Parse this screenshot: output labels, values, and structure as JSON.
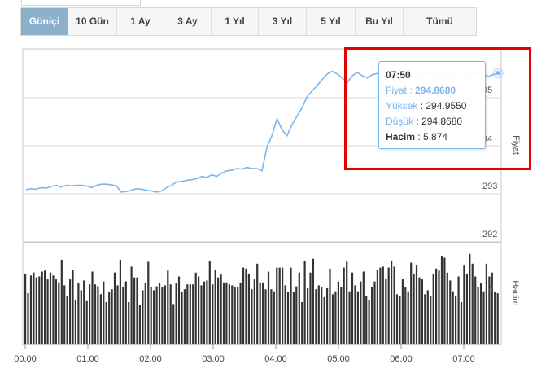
{
  "tabs": [
    {
      "label": "Güniçi",
      "active": true
    },
    {
      "label": "10 Gün",
      "active": false
    },
    {
      "label": "1 Ay",
      "active": false
    },
    {
      "label": "3 Ay",
      "active": false
    },
    {
      "label": "1 Yıl",
      "active": false
    },
    {
      "label": "3 Yıl",
      "active": false
    },
    {
      "label": "5 Yıl",
      "active": false
    },
    {
      "label": "Bu Yıl",
      "active": false
    },
    {
      "label": "Tümü",
      "active": false
    }
  ],
  "colors": {
    "accent": "#8ab0cc",
    "line": "#7cb5ec",
    "volume_bar": "#333333",
    "highlight_box": "#e60000"
  },
  "tooltip": {
    "time": "07:50",
    "price_label": "Fiyat",
    "price_value": "294.8680",
    "high_label": "Yüksek",
    "high_value": "294.9550",
    "low_label": "Düşük",
    "low_value": "294.8680",
    "volume_label": "Hacim",
    "volume_value": "5.874"
  },
  "chart_data": [
    {
      "type": "line",
      "ylabel": "Fiyat",
      "ylim": [
        291.85,
        295.3
      ],
      "yticks": [
        "292",
        "293",
        "94",
        "95"
      ],
      "x": [
        "00:00",
        "00:05",
        "00:10",
        "00:15",
        "00:20",
        "00:25",
        "00:30",
        "00:35",
        "00:40",
        "00:45",
        "00:50",
        "00:55",
        "01:00",
        "01:05",
        "01:10",
        "01:15",
        "01:20",
        "01:25",
        "01:30",
        "01:35",
        "01:40",
        "01:45",
        "01:50",
        "01:55",
        "02:00",
        "02:05",
        "02:10",
        "02:15",
        "02:20",
        "02:25",
        "02:30",
        "02:35",
        "02:40",
        "02:45",
        "02:50",
        "02:55",
        "03:00",
        "03:05",
        "03:10",
        "03:15",
        "03:20",
        "03:25",
        "03:30",
        "03:35",
        "03:40",
        "03:45",
        "03:50",
        "03:55",
        "04:00",
        "04:05",
        "04:10",
        "04:15",
        "04:20",
        "04:25",
        "04:30",
        "04:35",
        "04:40",
        "04:45",
        "04:50",
        "04:55",
        "05:00",
        "05:05",
        "05:10",
        "05:15",
        "05:20",
        "05:25",
        "05:30",
        "05:35",
        "05:40",
        "05:45",
        "05:50",
        "05:55",
        "06:00",
        "06:05",
        "06:10",
        "06:15",
        "06:20",
        "06:25",
        "06:30",
        "06:35",
        "06:40",
        "06:45",
        "06:50",
        "06:55",
        "07:00",
        "07:05",
        "07:10",
        "07:15",
        "07:20",
        "07:25",
        "07:30",
        "07:35",
        "07:40",
        "07:45",
        "07:50"
      ],
      "values": [
        292.78,
        292.8,
        292.79,
        292.82,
        292.81,
        292.84,
        292.86,
        292.83,
        292.86,
        292.85,
        292.86,
        292.86,
        292.85,
        292.82,
        292.86,
        292.88,
        292.88,
        292.87,
        292.85,
        292.74,
        292.75,
        292.77,
        292.8,
        292.79,
        292.77,
        292.76,
        292.74,
        292.76,
        292.82,
        292.86,
        292.92,
        292.93,
        292.95,
        292.96,
        292.98,
        293.02,
        293.0,
        293.05,
        293.02,
        293.08,
        293.12,
        293.13,
        293.16,
        293.15,
        293.18,
        293.16,
        293.16,
        293.12,
        293.55,
        293.75,
        294.05,
        293.85,
        293.75,
        293.95,
        294.1,
        294.25,
        294.45,
        294.55,
        294.65,
        294.75,
        294.85,
        294.9,
        294.85,
        294.78,
        294.7,
        294.82,
        294.88,
        294.82,
        294.78,
        294.84,
        294.86,
        294.8,
        294.78,
        294.82,
        294.86,
        294.9,
        294.84,
        294.8,
        294.82,
        294.86,
        294.88,
        294.84,
        294.82,
        294.86,
        294.82,
        294.84,
        294.82,
        294.8,
        294.84,
        294.86,
        294.88,
        294.86,
        294.8,
        294.84,
        294.868
      ]
    },
    {
      "type": "bar",
      "ylabel": "Hacim",
      "yticks": [
        "4",
        "4"
      ],
      "categories_axis": [
        "00:00",
        "01:00",
        "02:00",
        "03:00",
        "04:00",
        "05:00",
        "06:00",
        "07:00"
      ],
      "values": [
        7.2,
        5.2,
        7.0,
        7.3,
        6.8,
        6.9,
        7.4,
        7.5,
        6.6,
        7.3,
        7.0,
        6.6,
        6.3,
        8.6,
        6.0,
        4.9,
        6.6,
        7.6,
        4.5,
        6.2,
        5.5,
        6.5,
        4.4,
        6.1,
        7.4,
        6.1,
        5.9,
        5.1,
        6.4,
        4.3,
        5.3,
        5.6,
        7.3,
        6.0,
        8.6,
        5.8,
        6.4,
        4.3,
        7.9,
        6.8,
        6.8,
        4.0,
        5.5,
        6.2,
        8.4,
        5.8,
        5.5,
        5.9,
        6.2,
        5.8,
        6.0,
        7.5,
        6.1,
        4.1,
        6.2,
        6.9,
        5.3,
        5.6,
        6.1,
        6.1,
        6.1,
        7.3,
        6.9,
        6.0,
        6.4,
        6.5,
        8.5,
        6.1,
        7.6,
        6.8,
        7.1,
        6.3,
        6.3,
        6.1,
        6.0,
        5.8,
        5.8,
        6.3,
        7.8,
        7.7,
        7.2,
        5.6,
        6.6,
        8.2,
        6.3,
        6.3,
        5.6,
        7.4,
        5.6,
        5.4,
        7.8,
        7.8,
        7.8,
        6.0,
        5.3,
        7.8,
        5.3,
        5.9,
        7.3,
        4.3,
        8.5,
        5.7,
        7.3,
        8.7,
        5.6,
        6.0,
        5.8,
        4.8,
        5.7,
        7.7,
        5.1,
        5.4,
        6.4,
        5.8,
        7.8,
        8.4,
        5.4,
        7.3,
        6.0,
        5.4,
        6.4,
        7.4,
        4.9,
        4.5,
        5.8,
        6.4,
        7.6,
        7.8,
        7.9,
        6.7,
        7.8,
        8.5,
        7.9,
        5.1,
        4.9,
        6.6,
        5.8,
        5.4,
        8.3,
        7.2,
        8.1,
        6.8,
        6.6,
        5.1,
        5.5,
        4.9,
        7.2,
        7.7,
        7.5,
        9.0,
        8.8,
        7.3,
        6.5,
        5.4,
        4.9,
        6.9,
        4.3,
        8.0,
        7.2,
        9.2,
        8.2,
        6.9,
        5.8,
        6.2,
        5.4,
        8.2,
        6.9,
        7.3,
        5.3,
        5.2
      ]
    }
  ]
}
